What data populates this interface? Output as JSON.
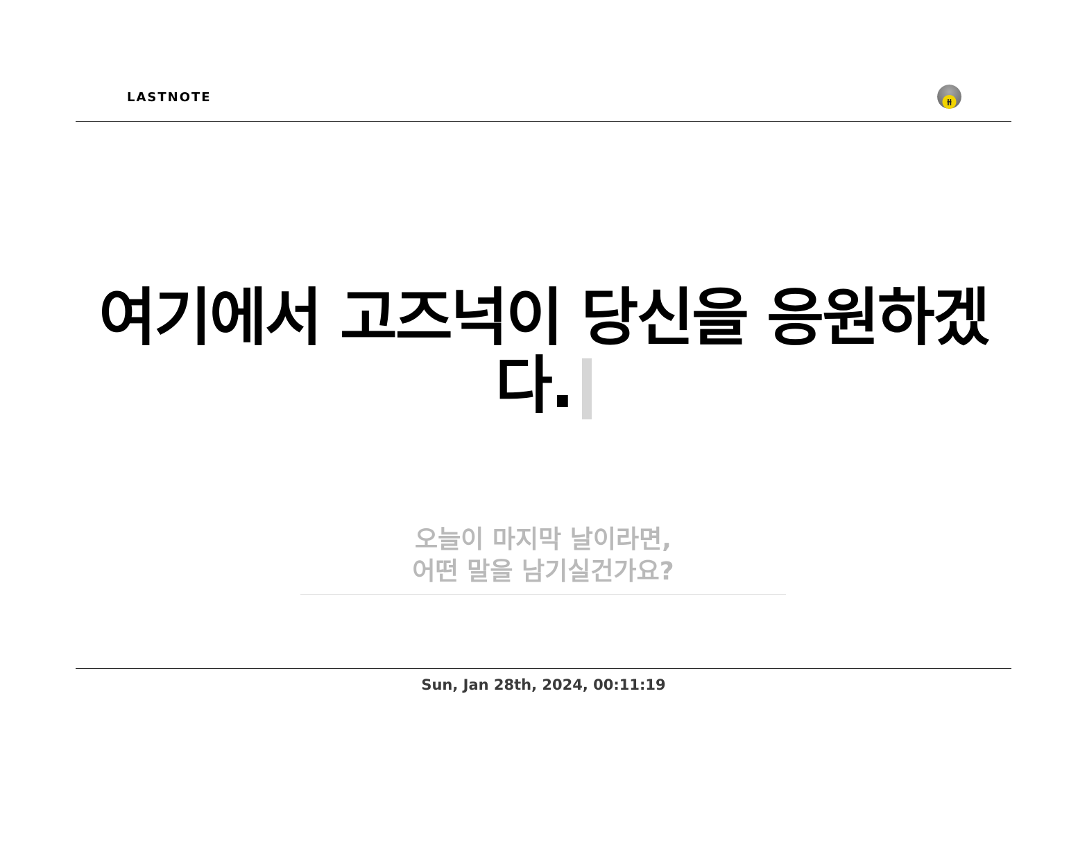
{
  "header": {
    "brand": "LASTNOTE",
    "avatar_icon": "user-avatar-icon"
  },
  "main": {
    "headline": "여기에서 고즈넉이 당신을 응원하겠다."
  },
  "note_input": {
    "placeholder": "오늘이 마지막 날이라면,\n어떤 말을 남기실건가요?",
    "value": ""
  },
  "footer": {
    "datetime": "Sun, Jan 28th, 2024, 00:11:19"
  },
  "colors": {
    "text": "#000000",
    "placeholder": "#b9b9b9",
    "cursor": "#d6d6d6",
    "divider": "#222222",
    "datetime": "#3a3a3a",
    "avatar_bg": "#8a8a8a",
    "avatar_accent": "#f2d400"
  }
}
